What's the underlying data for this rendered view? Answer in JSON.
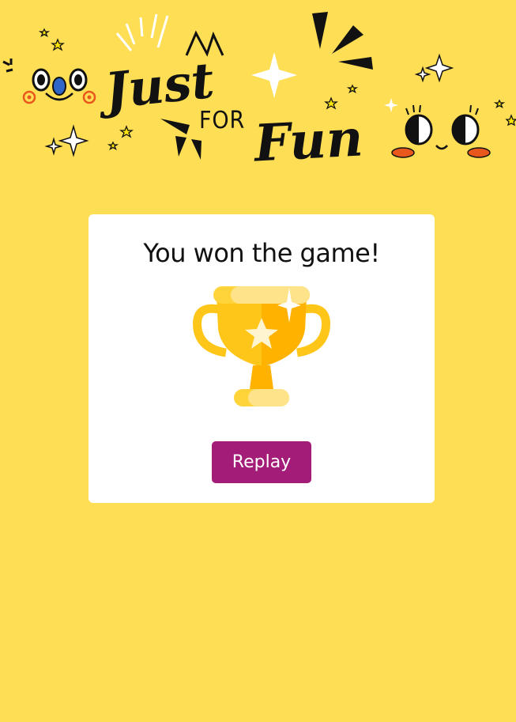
{
  "banner": {
    "line1": "Just",
    "line2": "FOR",
    "line3": "Fun",
    "colors": {
      "ink": "#111111",
      "cheek": "#E8571C",
      "star_fill": "#FFE600",
      "nose": "#2F67C9"
    }
  },
  "result": {
    "message": "You won the game!",
    "trophy_icon": "trophy-icon",
    "replay_label": "Replay"
  },
  "colors": {
    "background": "#FEDE55",
    "card": "#FFFFFF",
    "button": "#A31C78",
    "trophy": "#FFC61A"
  }
}
